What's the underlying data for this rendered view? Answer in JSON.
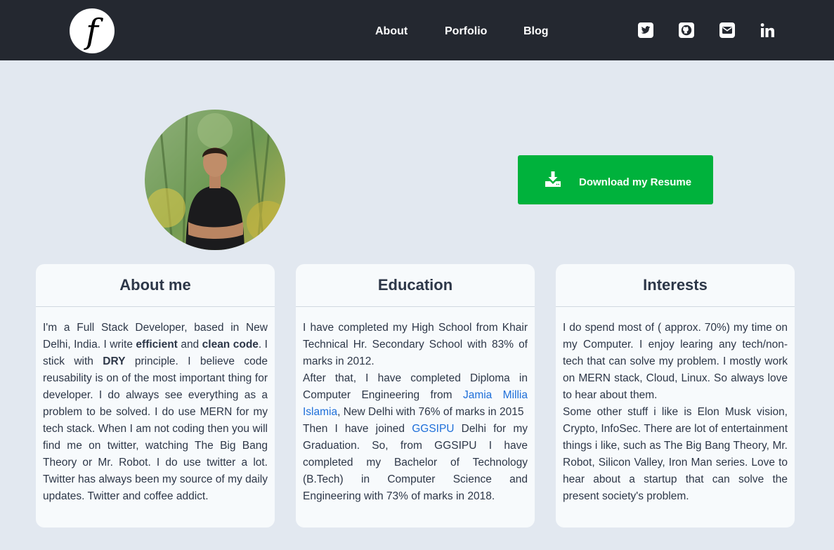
{
  "logo": {
    "glyph": "f"
  },
  "nav": {
    "links": [
      {
        "label": "About"
      },
      {
        "label": "Porfolio"
      },
      {
        "label": "Blog"
      }
    ],
    "social_icons": [
      "twitter-icon",
      "github-icon",
      "email-icon",
      "linkedin-icon"
    ]
  },
  "resume": {
    "label": "Download my Resume",
    "icon": "download-icon",
    "color": "#00b23c"
  },
  "about": {
    "title": "About me",
    "t1": "I'm a Full Stack Developer, based in New Delhi, India. I write ",
    "b1": "efficient",
    "t2": " and ",
    "b2": "clean code",
    "t3": ". I stick with ",
    "b3": "DRY",
    "t4": " principle. I believe code reusability is on of the most important thing for developer. I do always see everything as a problem to be solved. I do use MERN for my tech stack. When I am not coding then you will find me on twitter, watching The Big Bang Theory or Mr. Robot. I do use twitter a lot. Twitter has always been my source of my daily updates. Twitter and coffee addict."
  },
  "education": {
    "title": "Education",
    "p1": "I have completed my High School from Khair Technical Hr. Secondary School with 83% of marks in 2012.",
    "p2a": "After that, I have completed Diploma in Computer Engineering from ",
    "p2link": "Jamia Millia Islamia",
    "p2b": ", New Delhi with 76% of marks in 2015",
    "p3a": "Then I have joined ",
    "p3link": "GGSIPU",
    "p3b": " Delhi for my Graduation. So, from GGSIPU I have completed my Bachelor of Technology (B.Tech) in Computer Science and Engineering with 73% of marks in 2018."
  },
  "interests": {
    "title": "Interests",
    "p1": "I do spend most of ( approx. 70%) my time on my Computer. I enjoy learing any tech/non-tech that can solve my problem. I mostly work on MERN stack, Cloud, Linux. So always love to hear about them.",
    "p2": "Some other stuff i like is Elon Musk vision, Crypto, InfoSec. There are lot of entertainment things i like, such as The Big Bang Theory, Mr. Robot, Silicon Valley, Iron Man series. Love to hear about a startup that can solve the present society's problem."
  }
}
